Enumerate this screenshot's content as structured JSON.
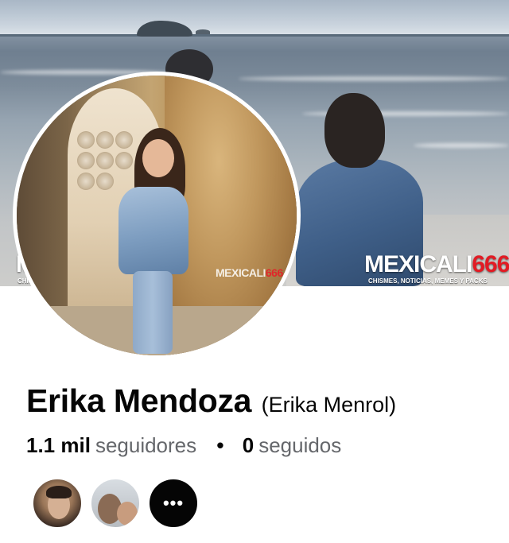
{
  "profile": {
    "name": "Erika Mendoza",
    "alternate_name": "(Erika Menrol)"
  },
  "stats": {
    "followers_count": "1.1 mil",
    "followers_label": "seguidores",
    "separator": "•",
    "following_count": "0",
    "following_label": "seguidos"
  },
  "watermarks": {
    "brand_word": "MEXICALI",
    "brand_number": "666",
    "tagline": "CHISMES, NOTICIAS, MEMES Y PACKS"
  },
  "mutual_friends": {
    "more_label": "•••",
    "more_icon": "more-horizontal-icon"
  },
  "colors": {
    "text_primary": "#050505",
    "text_secondary": "#65676b",
    "watermark_accent": "#e21b24",
    "more_button_bg": "#050505"
  }
}
